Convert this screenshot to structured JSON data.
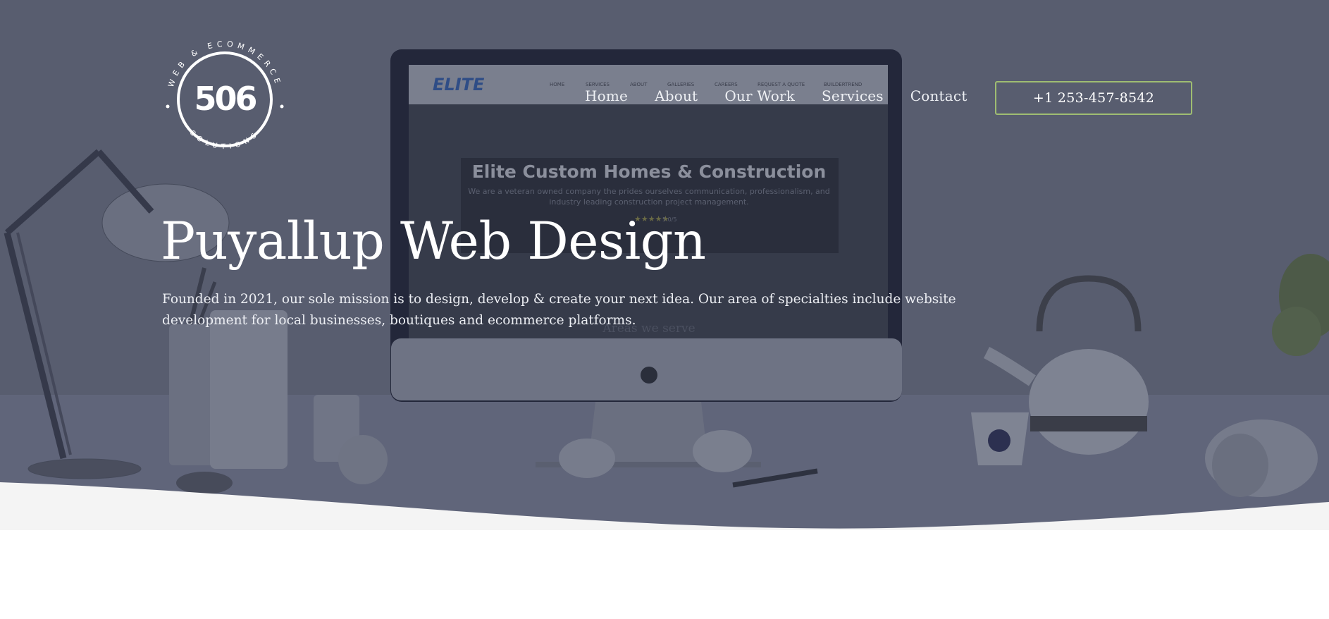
{
  "brand": {
    "logo_ring_text": "WEB & ECOMMERCE",
    "logo_number": "506",
    "logo_bottom_text": "SOLUTIONS"
  },
  "nav": {
    "items": [
      {
        "label": "Home"
      },
      {
        "label": "About"
      },
      {
        "label": "Our Work"
      },
      {
        "label": "Services"
      },
      {
        "label": "Contact"
      }
    ],
    "phone": "+1 253-457-8542"
  },
  "hero": {
    "title": "Puyallup Web Design",
    "description": "Founded in 2021, our sole mission is to design, develop & create your next idea. Our area of specialties include website development for local businesses, boutiques and ecommerce platforms."
  },
  "background_mockup": {
    "site_logo": "ELITE",
    "nav_items": [
      "HOME",
      "SERVICES",
      "ABOUT",
      "GALLERIES",
      "CAREERS",
      "REQUEST A QUOTE",
      "BUILDERTREND"
    ],
    "headline": "Elite Custom Homes & Construction",
    "subtext_line1": "We are a veteran owned company the prides ourselves communication, professionalism, and",
    "subtext_line2": "industry leading construction project management.",
    "rating": "5.0/5",
    "areas_heading": "Areas we serve"
  },
  "colors": {
    "hero_overlay": "#585d6f",
    "accent_border": "#9fbd72",
    "wave_fill": "#f4f4f4"
  }
}
